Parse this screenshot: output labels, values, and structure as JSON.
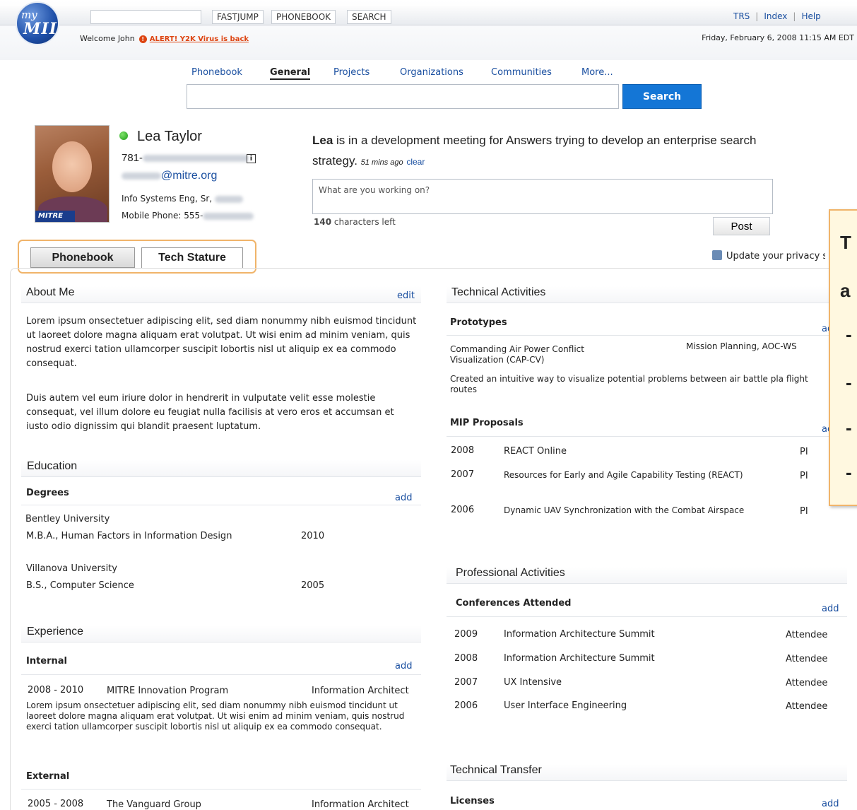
{
  "header": {
    "logo_my": "my",
    "logo_mii": "MII",
    "buttons": [
      "FASTJUMP",
      "PHONEBOOK",
      "SEARCH"
    ],
    "links": [
      "TRS",
      "Index",
      "Help"
    ],
    "welcome": "Welcome John",
    "alert_mark": "!",
    "alert": "ALERT! Y2K Virus is back",
    "datetime": "Friday, February 6, 2008  11:15 AM EDT"
  },
  "search": {
    "tabs": [
      "Phonebook",
      "General",
      "Projects",
      "Organizations",
      "Communities",
      "More..."
    ],
    "active_tab": "General",
    "query": "",
    "button": "Search"
  },
  "profile": {
    "badge": "MITRE",
    "name": "Lea Taylor",
    "phone_prefix": "781-",
    "info_icon": "i",
    "email_suffix": "@mitre.org",
    "title": "Info Systems Eng, Sr,",
    "mobile": "Mobile Phone: 555-"
  },
  "status": {
    "first_name": "Lea",
    "text": " is in a development meeting for Answers trying to develop an enterprise search strategy.",
    "ago": "51 mins ago",
    "clear": "clear",
    "placeholder": "What are you working on?",
    "chars_count": "140",
    "chars_label": " characters left",
    "post": "Post"
  },
  "profile_tabs": [
    "Phonebook",
    "Tech Stature"
  ],
  "privacy": "Update your privacy se",
  "about": {
    "title": "About Me",
    "edit": "edit",
    "p1": "Lorem ipsum onsectetuer adipiscing elit, sed diam nonummy nibh euismod tincidunt ut laoreet dolore magna aliquam erat volutpat. Ut wisi enim ad minim veniam, quis nostrud exerci tation ullamcorper suscipit lobortis nisl ut aliquip ex ea commodo consequat.",
    "p2": "Duis autem vel eum iriure dolor in hendrerit in vulputate velit esse molestie consequat, vel illum dolore eu feugiat nulla facilisis at vero eros et accumsan et iusto odio dignissim qui blandit praesent luptatum."
  },
  "education": {
    "title": "Education",
    "degrees_label": "Degrees",
    "add": "add",
    "items": [
      {
        "school": "Bentley University",
        "degree": "M.B.A., Human Factors in Information Design",
        "year": "2010"
      },
      {
        "school": "Villanova University",
        "degree": "B.S., Computer Science",
        "year": "2005"
      }
    ]
  },
  "experience": {
    "title": "Experience",
    "internal_label": "Internal",
    "add": "add",
    "internal": {
      "years": "2008 - 2010",
      "org": "MITRE Innovation Program",
      "role": "Information Architect",
      "desc": "Lorem ipsum onsectetuer adipiscing elit, sed diam nonummy nibh euismod tincidunt ut laoreet dolore magna aliquam erat volutpat. Ut wisi enim ad minim veniam, quis nostrud exerci tation ullamcorper suscipit lobortis nisl ut aliquip ex ea commodo consequat."
    },
    "external_label": "External",
    "external": {
      "years": "2005 - 2008",
      "org": "The Vanguard Group",
      "role": "Information Architect"
    }
  },
  "technical": {
    "title": "Technical Activities",
    "prototypes_label": "Prototypes",
    "add": "ad",
    "prototype": {
      "name": "Commanding Air Power Conflict Visualization (CAP-CV)",
      "tag": "Mission Planning, AOC-WS",
      "desc": "Created an intuitive way to visualize potential problems between air battle pla flight routes"
    },
    "mip_label": "MIP Proposals",
    "mip": [
      {
        "year": "2008",
        "name": "REACT Online",
        "role": "PI"
      },
      {
        "year": "2007",
        "name": "Resources for Early and Agile Capability Testing (REACT)",
        "role": "PI"
      },
      {
        "year": "2006",
        "name": "Dynamic UAV Synchronization with the Combat Airspace",
        "role": "PI"
      }
    ]
  },
  "professional": {
    "title": "Professional Activities",
    "conf_label": "Conferences Attended",
    "add": "add",
    "items": [
      {
        "year": "2009",
        "name": "Information Architecture Summit",
        "role": "Attendee"
      },
      {
        "year": "2008",
        "name": "Information Architecture Summit",
        "role": "Attendee"
      },
      {
        "year": "2007",
        "name": "UX Intensive",
        "role": "Attendee"
      },
      {
        "year": "2006",
        "name": "User Interface Engineering",
        "role": "Attendee"
      }
    ]
  },
  "transfer": {
    "title": "Technical Transfer",
    "licenses_label": "Licenses",
    "add": "add"
  },
  "callout": {
    "t": "T",
    "a": "a",
    "dash": "-"
  }
}
